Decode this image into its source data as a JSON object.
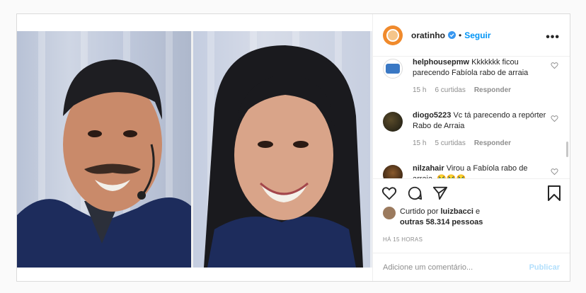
{
  "post": {
    "username": "oratinho",
    "follow_label": "Seguir",
    "separator": "•",
    "more_icon": "more-horizontal-icon",
    "more_label": "•••"
  },
  "comments": [
    {
      "user": "helphousepmw",
      "text": "Kkkkkkk ficou parecendo Fabíola rabo de arraia",
      "time": "15 h",
      "likes": "6 curtidas",
      "reply": "Responder"
    },
    {
      "user": "diogo5223",
      "text": "Vc tá parecendo a repórter Rabo de Arraia",
      "time": "15 h",
      "likes": "5 curtidas",
      "reply": "Responder"
    },
    {
      "user": "nilzahair",
      "text": "Virou a Fabíola rabo de arraia, 😭😭😭"
    }
  ],
  "liked_by": {
    "prefix": "Curtido por",
    "user": "luizbacci",
    "connector": "e",
    "others": "outras 58.314 pessoas"
  },
  "timestamp": "HÁ 15 HORAS",
  "add_comment": {
    "placeholder": "Adicione um comentário...",
    "publish_label": "Publicar"
  },
  "colors": {
    "accent": "#0095f6",
    "publish_disabled": "#b2dffc",
    "muted": "#8e8e8e"
  }
}
